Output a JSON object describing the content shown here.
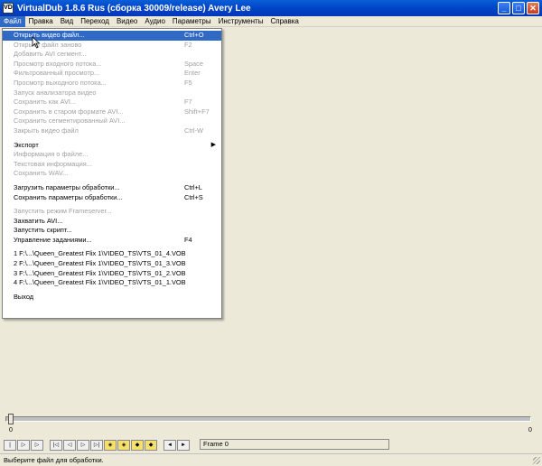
{
  "window": {
    "icon": "VD",
    "title": "VirtualDub 1.8.6 Rus (сборка 30009/release) Avery Lee",
    "minimize": "_",
    "maximize": "□",
    "close": "✕"
  },
  "menubar": {
    "items": [
      {
        "label": "Файл"
      },
      {
        "label": "Правка"
      },
      {
        "label": "Вид"
      },
      {
        "label": "Переход"
      },
      {
        "label": "Видео"
      },
      {
        "label": "Аудио"
      },
      {
        "label": "Параметры"
      },
      {
        "label": "Инструменты"
      },
      {
        "label": "Справка"
      }
    ]
  },
  "file_menu": {
    "group1": [
      {
        "label": "Открыть видео файл...",
        "shortcut": "Ctrl+O"
      },
      {
        "label": "Открыть файл заново",
        "shortcut": "F2"
      },
      {
        "label": "Добавить AVI сегмент...",
        "shortcut": ""
      },
      {
        "label": "Просмотр входного потока...",
        "shortcut": "Space"
      },
      {
        "label": "Фильтрованный просмотр...",
        "shortcut": "Enter"
      },
      {
        "label": "Просмотр выходного потока...",
        "shortcut": "F5"
      },
      {
        "label": "Запуск анализатора видео",
        "shortcut": ""
      },
      {
        "label": "Сохранить как AVI...",
        "shortcut": "F7"
      },
      {
        "label": "Сохранить в старом формате AVI...",
        "shortcut": "Shift+F7"
      },
      {
        "label": "Сохранить сегментированный AVI...",
        "shortcut": ""
      },
      {
        "label": "Закрыть видео файл",
        "shortcut": "Ctrl-W"
      }
    ],
    "group2": [
      {
        "label": "Экспорт",
        "arrow": "▶"
      },
      {
        "label": "Информация о файле..."
      },
      {
        "label": "Текстовая информация..."
      },
      {
        "label": "Сохранить WAV..."
      }
    ],
    "group3": [
      {
        "label": "Загрузить параметры обработки...",
        "shortcut": "Ctrl+L"
      },
      {
        "label": "Сохранить параметры обработки...",
        "shortcut": "Ctrl+S"
      }
    ],
    "group4": [
      {
        "label": "Запустить режим Frameserver...",
        "shortcut": ""
      },
      {
        "label": "Захватить AVI...",
        "shortcut": ""
      },
      {
        "label": "Запустить скрипт...",
        "shortcut": ""
      },
      {
        "label": "Управление заданиями...",
        "shortcut": "F4"
      }
    ],
    "recent": [
      {
        "label": "1 F:\\...\\Queen_Greatest Flix 1\\VIDEO_TS\\VTS_01_4.VOB"
      },
      {
        "label": "2 F:\\...\\Queen_Greatest Flix 1\\VIDEO_TS\\VTS_01_3.VOB"
      },
      {
        "label": "3 F:\\...\\Queen_Greatest Flix 1\\VIDEO_TS\\VTS_01_2.VOB"
      },
      {
        "label": "4 F:\\...\\Queen_Greatest Flix 1\\VIDEO_TS\\VTS_01_1.VOB"
      }
    ],
    "exit": {
      "label": "Выход"
    }
  },
  "timeline": {
    "start_tick": "0",
    "end_tick": "0"
  },
  "toolbar": {
    "buttons": [
      {
        "name": "stop",
        "icon": "stop-icon",
        "glyph": "|"
      },
      {
        "name": "play-input",
        "icon": "play-input-icon",
        "glyph": "▷"
      },
      {
        "name": "play-output",
        "icon": "play-output-icon",
        "glyph": "▷"
      },
      {
        "name": "start",
        "icon": "go-start-icon",
        "glyph": "|◁"
      },
      {
        "name": "back",
        "icon": "step-back-icon",
        "glyph": "◁"
      },
      {
        "name": "forward",
        "icon": "step-forward-icon",
        "glyph": "▷"
      },
      {
        "name": "end",
        "icon": "go-end-icon",
        "glyph": "▷|"
      },
      {
        "name": "prev-key",
        "icon": "prev-key-icon",
        "glyph": "◈"
      },
      {
        "name": "next-key",
        "icon": "next-key-icon",
        "glyph": "◈"
      },
      {
        "name": "prev-scene",
        "icon": "prev-scene-icon",
        "glyph": "◆"
      },
      {
        "name": "next-scene",
        "icon": "next-scene-icon",
        "glyph": "◆"
      },
      {
        "name": "mark-in",
        "icon": "mark-in-icon",
        "glyph": "◄"
      },
      {
        "name": "mark-out",
        "icon": "mark-out-icon",
        "glyph": "►"
      }
    ],
    "frame_label": "Frame 0"
  },
  "status": {
    "text": "Выберите файл для обработки."
  },
  "colors": {
    "highlight": "#316ac5",
    "titlebar": "#0046c8",
    "disabled_text": "#a0a0a0"
  }
}
